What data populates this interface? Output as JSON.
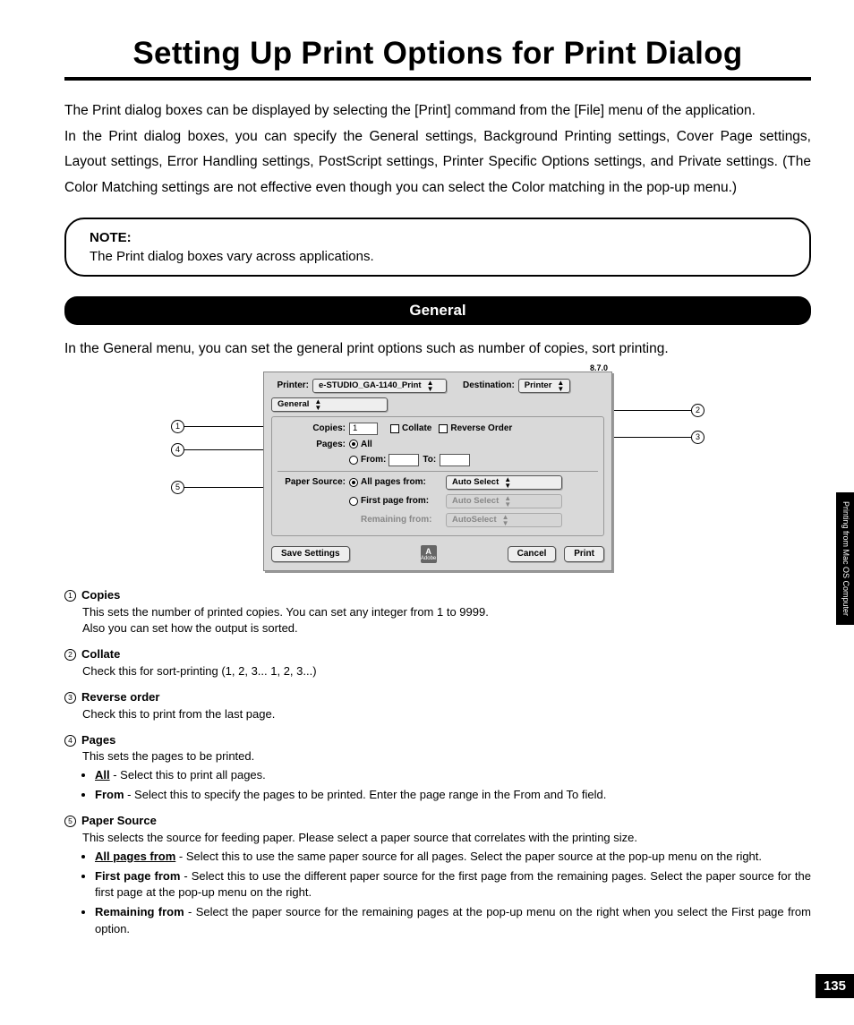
{
  "title": "Setting Up Print Options for Print Dialog",
  "intro": {
    "p1": "The Print dialog boxes can be displayed by selecting the [Print] command from the [File] menu of the application.",
    "p2": "In the Print dialog boxes, you can specify the General settings, Background Printing settings, Cover Page settings, Layout settings, Error Handling settings, PostScript settings, Printer Specific Options settings, and Private settings.  (The Color Matching settings are not effective even though you can select the Color matching in the pop-up menu.)"
  },
  "note": {
    "label": "NOTE:",
    "text": "The Print dialog boxes vary across applications."
  },
  "section": {
    "heading": "General",
    "intro": "In the General menu, you can set the general print options such as number of copies, sort printing."
  },
  "dialog": {
    "version": "8.7.0",
    "printer_label": "Printer:",
    "printer_value": "e-STUDIO_GA-1140_Print",
    "destination_label": "Destination:",
    "destination_value": "Printer",
    "panel_selector": "General",
    "copies_label": "Copies:",
    "copies_value": "1",
    "collate_label": "Collate",
    "reverse_label": "Reverse Order",
    "pages_label": "Pages:",
    "pages_all": "All",
    "pages_from": "From:",
    "pages_to": "To:",
    "papersource_label": "Paper Source:",
    "ps_allfrom": "All pages from:",
    "ps_allfrom_value": "Auto Select",
    "ps_firstfrom": "First page from:",
    "ps_firstfrom_value": "Auto Select",
    "ps_remaining": "Remaining from:",
    "ps_remaining_value": "AutoSelect",
    "btn_save": "Save Settings",
    "btn_cancel": "Cancel",
    "btn_print": "Print",
    "logo_text": "Adobe"
  },
  "callouts": {
    "c1": "1",
    "c2": "2",
    "c3": "3",
    "c4": "4",
    "c5": "5"
  },
  "defs": [
    {
      "num": "1",
      "title": "Copies",
      "lines": [
        "This sets the number of printed copies.  You can set any integer from 1 to 9999.",
        "Also you can set how the output is sorted."
      ]
    },
    {
      "num": "2",
      "title": "Collate",
      "lines": [
        "Check this for sort-printing (1, 2, 3... 1, 2, 3...)"
      ]
    },
    {
      "num": "3",
      "title": "Reverse order",
      "lines": [
        "Check this to print from the last page."
      ]
    },
    {
      "num": "4",
      "title": "Pages",
      "lines": [
        "This sets the pages to be printed."
      ],
      "bullets": [
        {
          "u": "All",
          "rest": " - Select this to print all pages."
        },
        {
          "b": "From",
          "rest": " - Select this to specify the pages to be printed.  Enter the page range in the From and To field."
        }
      ]
    },
    {
      "num": "5",
      "title": "Paper Source",
      "lines": [
        "This selects the source for feeding paper.  Please select a paper source that correlates with the printing size."
      ],
      "bullets": [
        {
          "u": "All pages from",
          "rest": " - Select this to use the same paper source for all pages.  Select the paper source at the pop-up menu on the right."
        },
        {
          "b": "First page from",
          "rest": " - Select this to use the different paper source for the first page from the remaining pages.  Select the paper source for the first page at the pop-up menu on the right."
        },
        {
          "b": "Remaining from",
          "rest": " - Select the paper source for the remaining pages at the pop-up menu on the right when you select the First page from option."
        }
      ]
    }
  ],
  "side_tab": "Printing from Mac OS Computer",
  "page_number": "135"
}
